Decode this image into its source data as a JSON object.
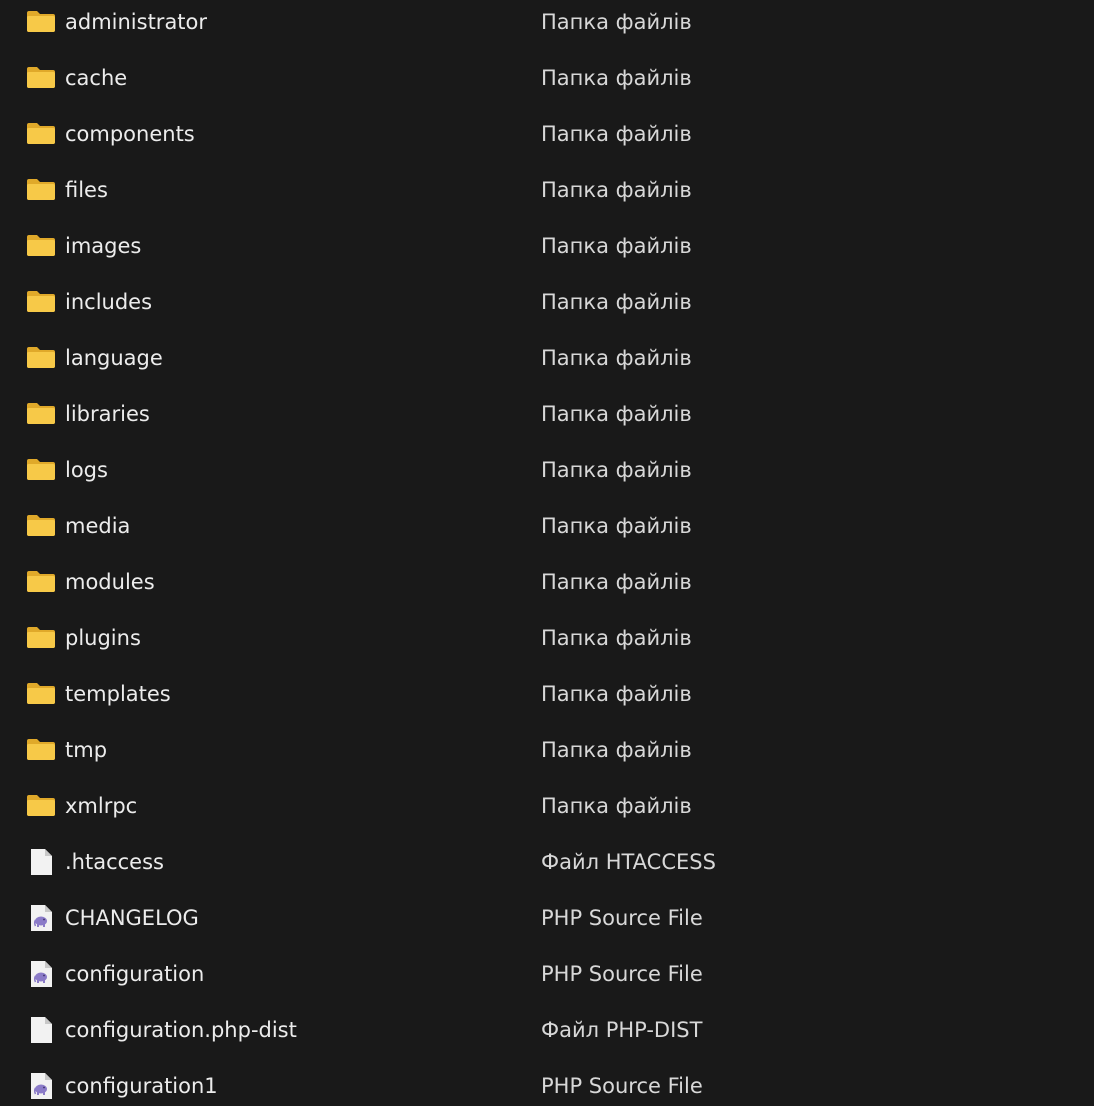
{
  "items": [
    {
      "name": "administrator",
      "type": "Папка файлів",
      "icon": "folder-icon"
    },
    {
      "name": "cache",
      "type": "Папка файлів",
      "icon": "folder-icon"
    },
    {
      "name": "components",
      "type": "Папка файлів",
      "icon": "folder-icon"
    },
    {
      "name": "files",
      "type": "Папка файлів",
      "icon": "folder-icon"
    },
    {
      "name": "images",
      "type": "Папка файлів",
      "icon": "folder-icon"
    },
    {
      "name": "includes",
      "type": "Папка файлів",
      "icon": "folder-icon"
    },
    {
      "name": "language",
      "type": "Папка файлів",
      "icon": "folder-icon"
    },
    {
      "name": "libraries",
      "type": "Папка файлів",
      "icon": "folder-icon"
    },
    {
      "name": "logs",
      "type": "Папка файлів",
      "icon": "folder-icon"
    },
    {
      "name": "media",
      "type": "Папка файлів",
      "icon": "folder-icon"
    },
    {
      "name": "modules",
      "type": "Папка файлів",
      "icon": "folder-icon"
    },
    {
      "name": "plugins",
      "type": "Папка файлів",
      "icon": "folder-icon"
    },
    {
      "name": "templates",
      "type": "Папка файлів",
      "icon": "folder-icon"
    },
    {
      "name": "tmp",
      "type": "Папка файлів",
      "icon": "folder-icon"
    },
    {
      "name": "xmlrpc",
      "type": "Папка файлів",
      "icon": "folder-icon"
    },
    {
      "name": ".htaccess",
      "type": "Файл HTACCESS",
      "icon": "blank-file-icon"
    },
    {
      "name": "CHANGELOG",
      "type": "PHP Source File",
      "icon": "php-file-icon"
    },
    {
      "name": "configuration",
      "type": "PHP Source File",
      "icon": "php-file-icon"
    },
    {
      "name": "configuration.php-dist",
      "type": "Файл PHP-DIST",
      "icon": "blank-file-icon"
    },
    {
      "name": "configuration1",
      "type": "PHP Source File",
      "icon": "php-file-icon"
    }
  ],
  "colors": {
    "background": "#191919",
    "folder": "#f7c948",
    "folder_dark": "#e0a92a",
    "php_elephant": "#8b7bc8"
  }
}
